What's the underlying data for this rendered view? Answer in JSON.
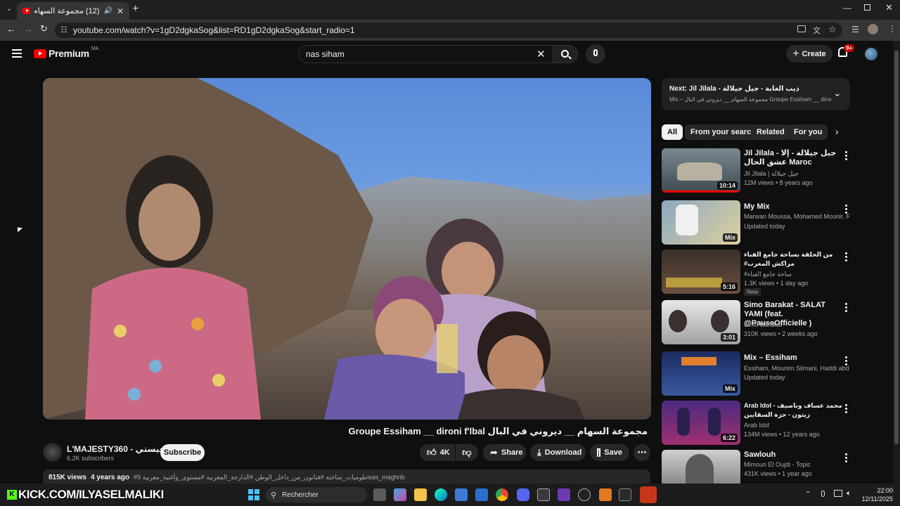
{
  "browser": {
    "tab_title": "(12) مجموعة السهام __ ديرو...",
    "url": "youtube.com/watch?v=1gD2dgkaSog&list=RD1gD2dgkaSog&start_radio=1"
  },
  "header": {
    "logo_text": "Premium",
    "region": "MA",
    "search_value": "nas siham",
    "create_label": "Create",
    "notif_count": "9+"
  },
  "video": {
    "title": "مجموعة السهام __ ديروني في البال Groupe Essiham __ dironi f'lbal",
    "channel": "L'MAJESTY360 - الماجيستي",
    "subscribers": "6.2K subscribers",
    "subscribe_label": "Subscribe",
    "likes": "4K",
    "share_label": "Share",
    "download_label": "Download",
    "save_label": "Save",
    "views": "815K views",
    "age": "4 years ago",
    "hashtags": "#طومبات_ساخنة #فنانون_من_داخل_الوطن #الدارجة_المغربية #مستوى_وأغنية_مغربية 9isas_maghrib"
  },
  "playlist_next": {
    "label": "Next:",
    "title": "Jil Jilala - ذيب الغابة - جيل جيلالة",
    "sub": "Mix – مجموعة السهام __ ديروني في البال Groupe Essiham __ dironi f'l..."
  },
  "chips": [
    "All",
    "From your search",
    "Related",
    "For you"
  ],
  "related": [
    {
      "title": "Jil Jilala - جيل جيلالة - إلا عشق الحال Maroc",
      "channel": "Jil Jilala | جيل جيلالة",
      "meta": "12M views • 8 years ago",
      "duration": "10:14"
    },
    {
      "title": "My Mix",
      "channel": "Marwan Moussa, Mohamed Mounir, Rac...",
      "meta": "Updated today",
      "duration": "Mix"
    },
    {
      "title": "من الحلقة بساحة جامع الفناء مراكش المغرب#",
      "channel": "#ساحة جامع الفناء",
      "meta": "1.3K views • 1 day ago",
      "badge": "New",
      "duration": "5:16"
    },
    {
      "title": "Simo Barakat - SALAT YAMI (feat. @PauseOfficielle )",
      "channel": "Simo Barakat",
      "meta": "310K views • 2 weeks ago",
      "duration": "3:01"
    },
    {
      "title": "Mix – Essiham",
      "channel": "Essiham, Mounim Slimani, Haddi abdera...",
      "meta": "Updated today",
      "duration": "Mix"
    },
    {
      "title": "Arab Idol - محمد عساف وناصيف زيتون - حزة السقايين",
      "channel": "Arab Idol",
      "meta": "134M views • 12 years ago",
      "duration": "6:22"
    },
    {
      "title": "Sawlouh",
      "channel": "Mimoun El Oujdi - Topic",
      "meta": "431K views • 1 year ago",
      "duration": ""
    }
  ],
  "taskbar": {
    "overlay_text": "KICK.COM/ILYASELMALIKI",
    "search_label": "Rechercher",
    "time": "22:00",
    "date": "12/11/2025"
  }
}
